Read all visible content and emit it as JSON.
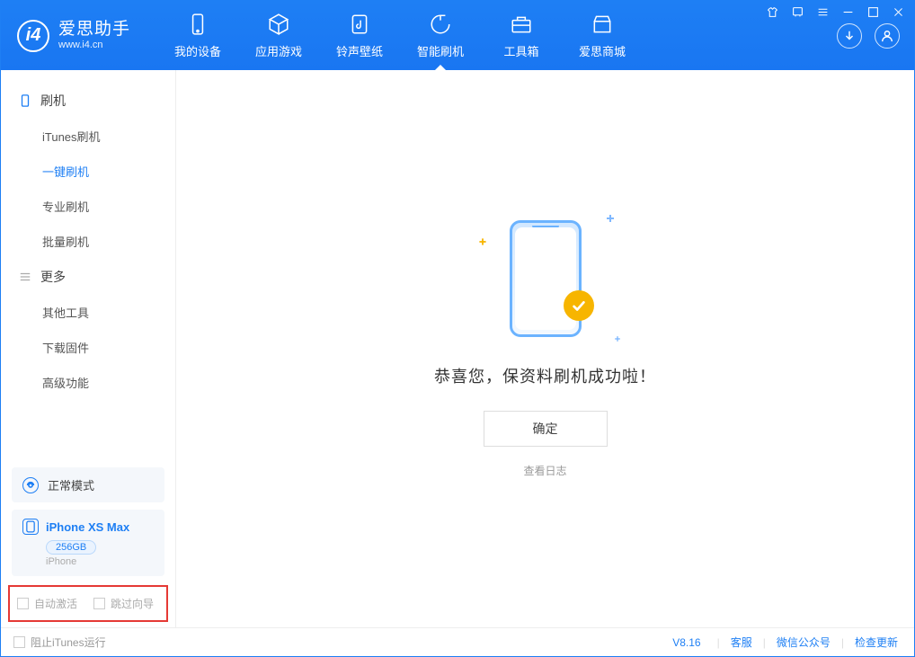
{
  "app": {
    "name_cn": "爱思助手",
    "name_en": "www.i4.cn",
    "logo_letter": "i4"
  },
  "nav": {
    "tabs": [
      {
        "label": "我的设备"
      },
      {
        "label": "应用游戏"
      },
      {
        "label": "铃声壁纸"
      },
      {
        "label": "智能刷机"
      },
      {
        "label": "工具箱"
      },
      {
        "label": "爱思商城"
      }
    ]
  },
  "sidebar": {
    "group1_title": "刷机",
    "group1_items": [
      "iTunes刷机",
      "一键刷机",
      "专业刷机",
      "批量刷机"
    ],
    "group2_title": "更多",
    "group2_items": [
      "其他工具",
      "下载固件",
      "高级功能"
    ],
    "status_mode": "正常模式",
    "device": {
      "name": "iPhone XS Max",
      "storage": "256GB",
      "type": "iPhone"
    }
  },
  "checkboxes": {
    "auto_activate": "自动激活",
    "skip_guide": "跳过向导"
  },
  "main": {
    "success_text": "恭喜您，保资料刷机成功啦！",
    "ok_button": "确定",
    "view_log": "查看日志"
  },
  "footer": {
    "block_itunes": "阻止iTunes运行",
    "version": "V8.16",
    "support": "客服",
    "wechat": "微信公众号",
    "check_update": "检查更新"
  }
}
